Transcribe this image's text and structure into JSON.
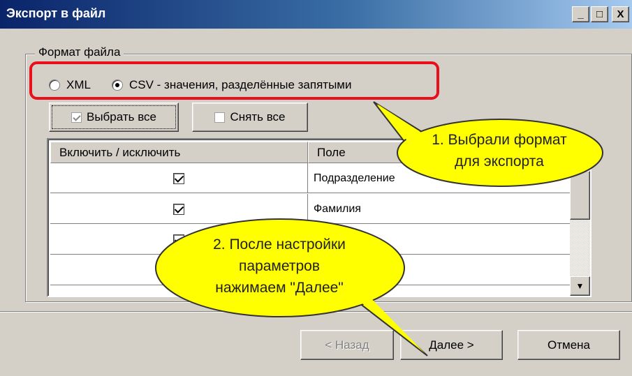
{
  "window": {
    "title": "Экспорт в файл",
    "controls": {
      "minimize": "_",
      "maximize": "□",
      "close": "X"
    }
  },
  "format_group": {
    "label": "Формат файла",
    "options": [
      {
        "label": "XML",
        "selected": false
      },
      {
        "label": "CSV - значения, разделённые запятыми",
        "selected": true
      }
    ]
  },
  "toolbar": {
    "select_all_label": "Выбрать все",
    "deselect_all_label": "Снять все"
  },
  "grid": {
    "columns": [
      "Включить / исключить",
      "Поле"
    ],
    "rows": [
      {
        "include": true,
        "field": "Подразделение"
      },
      {
        "include": true,
        "field": "Фамилия"
      },
      {
        "include": true,
        "field": ""
      },
      {
        "include": false,
        "field": ""
      }
    ]
  },
  "footer": {
    "back_label": "< Назад",
    "next_label": "Далее >",
    "cancel_label": "Отмена"
  },
  "annotations": {
    "callout_1": [
      "1. Выбрали формат",
      "для экспорта"
    ],
    "callout_2": [
      "2. После настройки",
      "параметров",
      "нажимаем \"Далее\""
    ],
    "highlight_color": "#e8101a",
    "callout_fill": "#ffff00"
  },
  "colors": {
    "titlebar_start": "#0a246a",
    "titlebar_end": "#a6caf0",
    "face": "#d4d0c8"
  }
}
